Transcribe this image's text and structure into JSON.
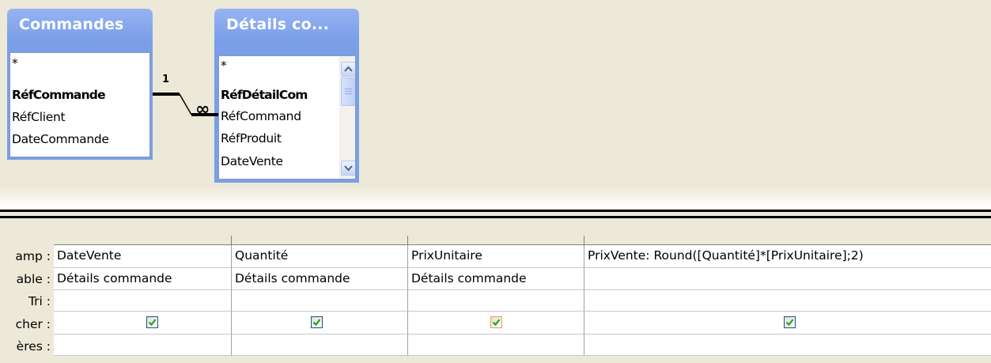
{
  "tables": {
    "commandes": {
      "title": "Commandes",
      "fields": [
        "*",
        "RéfCommande",
        "RéfClient",
        "DateCommande"
      ]
    },
    "details": {
      "title": "Détails co...",
      "fields": [
        "*",
        "RéfDétailCom",
        "RéfCommand",
        "RéfProduit",
        "DateVente"
      ]
    }
  },
  "relationship": {
    "one_label": "1",
    "many_label": "∞"
  },
  "grid": {
    "row_labels": [
      "amp :",
      "able :",
      "Tri :",
      "cher :",
      "ères :"
    ],
    "columns": [
      {
        "field": "DateVente",
        "table": "Détails commande",
        "show": true
      },
      {
        "field": "Quantité",
        "table": "Détails commande",
        "show": true
      },
      {
        "field": "PrixUnitaire",
        "table": "Détails commande",
        "show": true
      },
      {
        "field": "PrixVente: Round([Quantité]*[PrixUnitaire];2)",
        "table": "",
        "show": true
      }
    ]
  }
}
